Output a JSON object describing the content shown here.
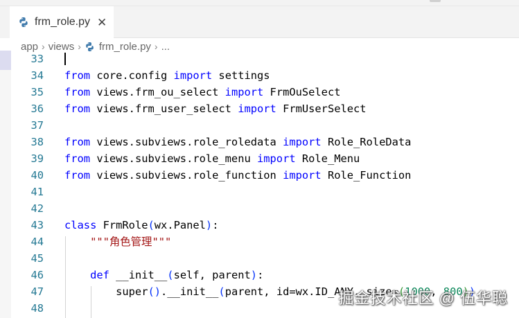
{
  "tab": {
    "label": "frm_role.py",
    "close": "✕"
  },
  "breadcrumb": {
    "items": [
      "app",
      "views",
      "frm_role.py",
      "..."
    ],
    "sep": "›"
  },
  "lines": [
    {
      "num": "33",
      "tokens": []
    },
    {
      "num": "34",
      "tokens": [
        [
          "kw",
          "from"
        ],
        [
          "t",
          " core.config "
        ],
        [
          "kw",
          "import"
        ],
        [
          "t",
          " settings"
        ]
      ]
    },
    {
      "num": "35",
      "tokens": [
        [
          "kw",
          "from"
        ],
        [
          "t",
          " views.frm_ou_select "
        ],
        [
          "kw",
          "import"
        ],
        [
          "t",
          " FrmOuSelect"
        ]
      ]
    },
    {
      "num": "36",
      "tokens": [
        [
          "kw",
          "from"
        ],
        [
          "t",
          " views.frm_user_select "
        ],
        [
          "kw",
          "import"
        ],
        [
          "t",
          " FrmUserSelect"
        ]
      ]
    },
    {
      "num": "37",
      "tokens": []
    },
    {
      "num": "38",
      "tokens": [
        [
          "kw",
          "from"
        ],
        [
          "t",
          " views.subviews.role_roledata "
        ],
        [
          "kw",
          "import"
        ],
        [
          "t",
          " Role_RoleData"
        ]
      ]
    },
    {
      "num": "39",
      "tokens": [
        [
          "kw",
          "from"
        ],
        [
          "t",
          " views.subviews.role_menu "
        ],
        [
          "kw",
          "import"
        ],
        [
          "t",
          " Role_Menu"
        ]
      ]
    },
    {
      "num": "40",
      "tokens": [
        [
          "kw",
          "from"
        ],
        [
          "t",
          " views.subviews.role_function "
        ],
        [
          "kw",
          "import"
        ],
        [
          "t",
          " Role_Function"
        ]
      ]
    },
    {
      "num": "41",
      "tokens": []
    },
    {
      "num": "42",
      "tokens": []
    },
    {
      "num": "43",
      "tokens": [
        [
          "kw",
          "class"
        ],
        [
          "t",
          " FrmRole"
        ],
        [
          "p1",
          "("
        ],
        [
          "t",
          "wx.Panel"
        ],
        [
          "p1",
          ")"
        ],
        [
          "t",
          ":"
        ]
      ]
    },
    {
      "num": "44",
      "tokens": [
        [
          "t",
          "    "
        ],
        [
          "str",
          "\"\"\"角色管理\"\"\""
        ]
      ]
    },
    {
      "num": "45",
      "tokens": []
    },
    {
      "num": "46",
      "tokens": [
        [
          "t",
          "    "
        ],
        [
          "kw",
          "def"
        ],
        [
          "t",
          " __init__"
        ],
        [
          "p1",
          "("
        ],
        [
          "t",
          "self, parent"
        ],
        [
          "p1",
          ")"
        ],
        [
          "t",
          ":"
        ]
      ]
    },
    {
      "num": "47",
      "tokens": [
        [
          "t",
          "        super"
        ],
        [
          "p1",
          "()"
        ],
        [
          "t",
          ".__init__"
        ],
        [
          "p1",
          "("
        ],
        [
          "t",
          "parent, id=wx.ID_ANY, size="
        ],
        [
          "p2",
          "("
        ],
        [
          "num",
          "1000"
        ],
        [
          "t",
          ", "
        ],
        [
          "num",
          "800"
        ],
        [
          "p2",
          ")"
        ],
        [
          "p1",
          ")"
        ]
      ]
    },
    {
      "num": "48",
      "tokens": []
    }
  ],
  "watermark": "掘金技术社区 @ 伍华聪"
}
